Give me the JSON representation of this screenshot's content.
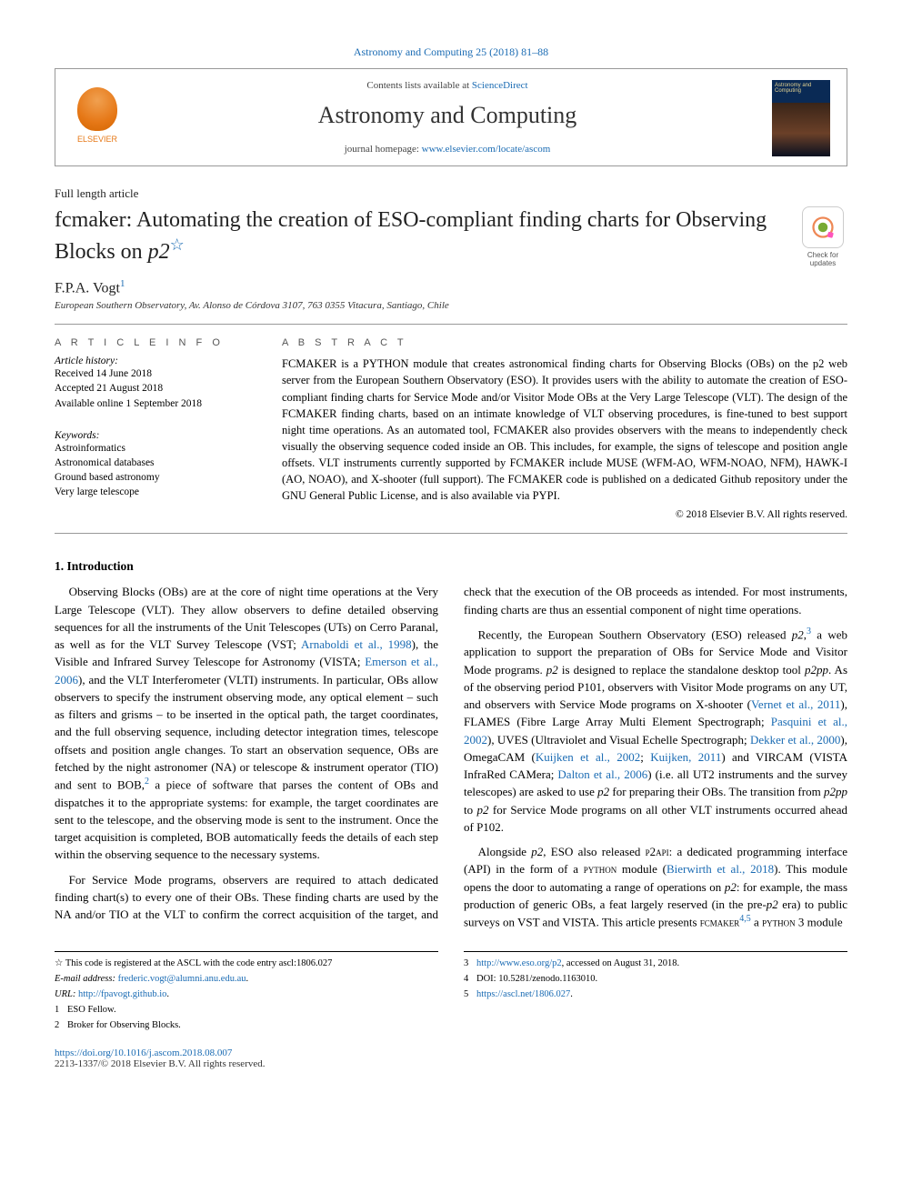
{
  "citation_header": "Astronomy and Computing 25 (2018) 81–88",
  "header": {
    "contents_prefix": "Contents lists available at ",
    "contents_link": "ScienceDirect",
    "journal_title": "Astronomy and Computing",
    "homepage_prefix": "journal homepage: ",
    "homepage_link": "www.elsevier.com/locate/ascom",
    "publisher": "ELSEVIER",
    "cover_text": "Astronomy and Computing"
  },
  "article": {
    "type": "Full length article",
    "title_prefix": "fcmaker: Automating the creation of ESO-compliant finding charts for Observing Blocks on ",
    "title_ital": "p2",
    "title_star": "☆",
    "authors": "F.P.A. Vogt",
    "author_sup": "1",
    "affiliation": "European Southern Observatory, Av. Alonso de Córdova 3107, 763 0355 Vitacura, Santiago, Chile",
    "check_updates": "Check for updates"
  },
  "info": {
    "heading": "A R T I C L E   I N F O",
    "history_label": "Article history:",
    "received": "Received 14 June 2018",
    "accepted": "Accepted 21 August 2018",
    "online": "Available online 1 September 2018",
    "keywords_label": "Keywords:",
    "kw1": "Astroinformatics",
    "kw2": "Astronomical databases",
    "kw3": "Ground based astronomy",
    "kw4": "Very large telescope"
  },
  "abstract": {
    "heading": "A B S T R A C T",
    "text": "FCMAKER is a PYTHON module that creates astronomical finding charts for Observing Blocks (OBs) on the p2 web server from the European Southern Observatory (ESO). It provides users with the ability to automate the creation of ESO-compliant finding charts for Service Mode and/or Visitor Mode OBs at the Very Large Telescope (VLT). The design of the FCMAKER finding charts, based on an intimate knowledge of VLT observing procedures, is fine-tuned to best support night time operations. As an automated tool, FCMAKER also provides observers with the means to independently check visually the observing sequence coded inside an OB. This includes, for example, the signs of telescope and position angle offsets. VLT instruments currently supported by FCMAKER include MUSE (WFM-AO, WFM-NOAO, NFM), HAWK-I (AO, NOAO), and X-shooter (full support). The FCMAKER code is published on a dedicated Github repository under the GNU General Public License, and is also available via PYPI.",
    "copyright": "© 2018 Elsevier B.V. All rights reserved."
  },
  "section1_heading": "1. Introduction",
  "body": {
    "p1a": "Observing Blocks (OBs) are at the core of night time operations at the Very Large Telescope (VLT). They allow observers to define detailed observing sequences for all the instruments of the Unit Telescopes (UTs) on Cerro Paranal, as well as for the VLT Survey Telescope (VST; ",
    "p1_cite1": "Arnaboldi et al., 1998",
    "p1b": "), the Visible and Infrared Survey Telescope for Astronomy (VISTA; ",
    "p1_cite2": "Emerson et al., 2006",
    "p1c": "), and the VLT Interferometer (VLTI) instruments. In particular, OBs allow observers to specify the instrument observing mode, any optical element – such as filters and grisms – to be inserted in the optical path, the target coordinates, and the full observing sequence, including detector integration times, telescope offsets and position angle changes. To start an observation sequence, OBs are fetched by the night astronomer (NA) or telescope & instrument operator (TIO) and sent to BOB,",
    "p1_fn2": "2",
    "p1d": " a piece of software that parses the content of OBs and dispatches it to the appropriate systems: for example, the target coordinates are sent to the telescope, and the observing mode is sent to the instrument. Once the target acquisition is completed, BOB automatically feeds the details of each step within the observing sequence to the necessary systems.",
    "p2a": "For Service Mode programs, observers are required to attach dedicated finding chart(s) to every one of their OBs. These finding charts are used by the NA and/or TIO at the VLT to confirm the correct acquisition of the target, and check that the execution of the OB proceeds as intended. For most instruments, finding charts are thus an essential component of night time operations.",
    "p3a": "Recently, the European Southern Observatory (ESO) released ",
    "p3_ital1": "p2",
    "p3b": ",",
    "p3_fn3": "3",
    "p3c": " a web application to support the preparation of OBs for Service Mode and Visitor Mode programs. ",
    "p3_ital2": "p2",
    "p3d": " is designed to replace the standalone desktop tool ",
    "p3_ital3": "p2pp",
    "p3e": ". As of the observing period P101, observers with Visitor Mode programs on any UT, and observers with Service Mode programs on X-shooter (",
    "p3_cite1": "Vernet et al., 2011",
    "p3f": "), FLAMES (Fibre Large Array Multi Element Spectrograph; ",
    "p3_cite2": "Pasquini et al., 2002",
    "p3g": "), UVES (Ultraviolet and Visual Echelle Spectrograph; ",
    "p3_cite3": "Dekker et al., 2000",
    "p3h": "), OmegaCAM (",
    "p3_cite4": "Kuijken et al., 2002",
    "p3i": "; ",
    "p3_cite5": "Kuijken, 2011",
    "p3j": ") and VIRCAM (VISTA InfraRed CAMera; ",
    "p3_cite6": "Dalton et al., 2006",
    "p3k": ") (i.e. all UT2 instruments and the survey telescopes) are asked to use ",
    "p3_ital4": "p2",
    "p3l": " for preparing their OBs. The transition from ",
    "p3_ital5": "p2pp",
    "p3m": " to ",
    "p3_ital6": "p2",
    "p3n": " for Service Mode programs on all other VLT instruments occurred ahead of P102.",
    "p4a": "Alongside ",
    "p4_ital1": "p2",
    "p4b": ", ESO also released ",
    "p4_sc1": "p2api",
    "p4c": ": a dedicated programming interface (API) in the form of a ",
    "p4_sc2": "python",
    "p4d": " module (",
    "p4_cite1": "Bierwirth et al., 2018",
    "p4e": "). This module opens the door to automating a range of operations on ",
    "p4_ital2": "p2",
    "p4f": ": for example, the mass production of generic OBs, a feat largely reserved (in the pre-",
    "p4_ital3": "p2",
    "p4g": " era) to public surveys on VST and VISTA. This article presents ",
    "p4_sc3": "fcmaker",
    "p4_fn45": "4,5",
    "p4h": " a ",
    "p4_sc4": "python",
    "p4i": " 3 module"
  },
  "footnotes_left": {
    "star": "☆ This code is registered at the ASCL with the code entry ascl:1806.027",
    "email_label": "E-mail address: ",
    "email": "frederic.vogt@alumni.anu.edu.au",
    "url_label": "URL: ",
    "url": "http://fpavogt.github.io",
    "fn1": "ESO Fellow.",
    "fn2": "Broker for Observing Blocks."
  },
  "footnotes_right": {
    "fn3": "http://www.eso.org/p2",
    "fn3_suffix": ", accessed on August 31, 2018.",
    "fn4": "DOI: 10.5281/zenodo.1163010.",
    "fn5": "https://ascl.net/1806.027"
  },
  "doi": {
    "link": "https://doi.org/10.1016/j.ascom.2018.08.007",
    "issn": "2213-1337/© 2018 Elsevier B.V. All rights reserved."
  }
}
